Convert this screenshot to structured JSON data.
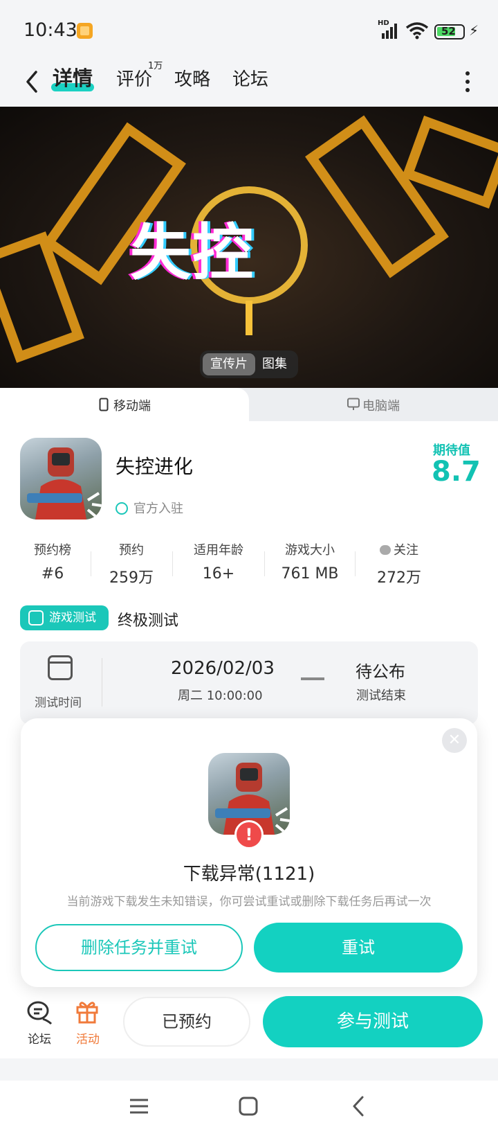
{
  "status_bar": {
    "time": "10:43",
    "network": "HD",
    "battery": "52"
  },
  "nav": {
    "tabs": [
      {
        "label": "详情",
        "active": true
      },
      {
        "label": "评价",
        "badge": "1万"
      },
      {
        "label": "攻略"
      },
      {
        "label": "论坛"
      }
    ]
  },
  "banner": {
    "title": "失控",
    "toggle": {
      "video": "宣传片",
      "gallery": "图集"
    }
  },
  "platform_tabs": {
    "mobile": "移动端",
    "pc": "电脑端"
  },
  "game": {
    "name": "失控进化",
    "official": "官方入驻",
    "expectation_label": "期待值",
    "expectation_value": "8.7"
  },
  "stats": [
    {
      "label": "预约榜",
      "value": "#6"
    },
    {
      "label": "预约",
      "value": "259万"
    },
    {
      "label": "适用年龄",
      "value": "16+"
    },
    {
      "label": "游戏大小",
      "value": "761 MB"
    },
    {
      "label": "关注",
      "value": "272万"
    }
  ],
  "test": {
    "badge": "游戏测试",
    "name": "终极测试",
    "time_label": "测试时间",
    "start_date": "2026/02/03",
    "start_time": "周二  10:00:00",
    "end_date": "待公布",
    "end_label": "测试结束"
  },
  "dialog": {
    "title": "下载异常(1121)",
    "message": "当前游戏下载发生未知错误，你可尝试重试或删除下载任务后再试一次",
    "delete_retry": "删除任务并重试",
    "retry": "重试"
  },
  "bottom": {
    "forum": "论坛",
    "activity": "活动",
    "reserved": "已预约",
    "join": "参与测试"
  },
  "colors": {
    "accent": "#13d1c1",
    "error": "#ef4a4a",
    "activity": "#f07a3a"
  }
}
